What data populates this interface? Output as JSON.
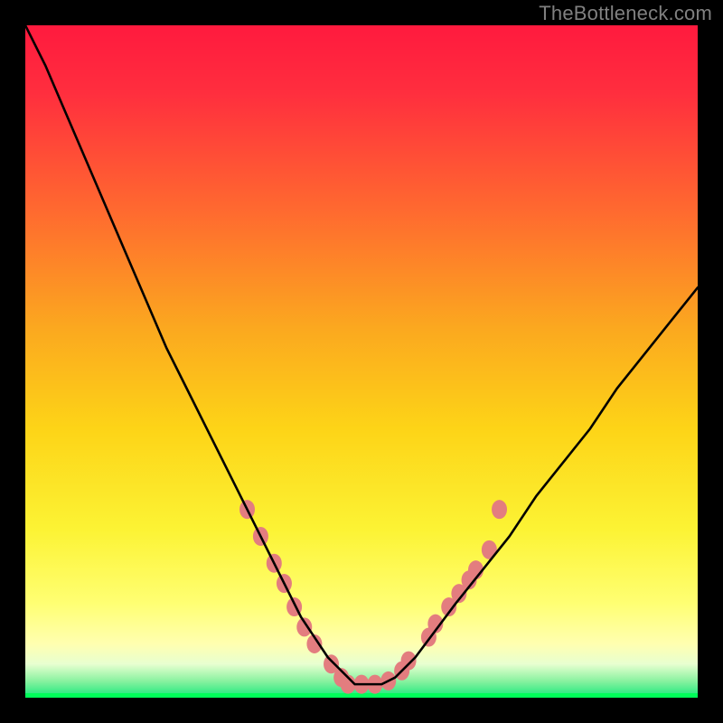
{
  "watermark": "TheBottleneck.com",
  "chart_data": {
    "type": "line",
    "title": "",
    "xlabel": "",
    "ylabel": "",
    "xlim": [
      0,
      100
    ],
    "ylim": [
      0,
      100
    ],
    "background_gradient": {
      "top": "#ff2040",
      "upper_mid": "#fdc419",
      "lower_mid": "#ffff66",
      "green_band": "#12e87a",
      "bright_green_line": "#00ff66"
    },
    "series": [
      {
        "name": "bottleneck-curve",
        "x": [
          0,
          3,
          6,
          9,
          12,
          15,
          18,
          21,
          24,
          27,
          30,
          33,
          35,
          37,
          39,
          41,
          43,
          45,
          47,
          49,
          51,
          53,
          55,
          58,
          61,
          64,
          68,
          72,
          76,
          80,
          84,
          88,
          92,
          96,
          100
        ],
        "y": [
          100,
          94,
          87,
          80,
          73,
          66,
          59,
          52,
          46,
          40,
          34,
          28,
          24,
          20,
          16,
          12,
          9,
          6,
          4,
          2,
          2,
          2,
          3,
          6,
          10,
          14,
          19,
          24,
          30,
          35,
          40,
          46,
          51,
          56,
          61
        ]
      }
    ],
    "markers": {
      "name": "data-points",
      "note": "pink rounded markers on lower part of both arms of the curve",
      "color": "#e37d7f",
      "points": [
        {
          "x": 33,
          "y": 28
        },
        {
          "x": 35,
          "y": 24
        },
        {
          "x": 37,
          "y": 20
        },
        {
          "x": 38.5,
          "y": 17
        },
        {
          "x": 40,
          "y": 13.5
        },
        {
          "x": 41.5,
          "y": 10.5
        },
        {
          "x": 43,
          "y": 8
        },
        {
          "x": 45.5,
          "y": 5
        },
        {
          "x": 47,
          "y": 3
        },
        {
          "x": 48,
          "y": 2
        },
        {
          "x": 50,
          "y": 2
        },
        {
          "x": 52,
          "y": 2
        },
        {
          "x": 54,
          "y": 2.5
        },
        {
          "x": 56,
          "y": 4
        },
        {
          "x": 57,
          "y": 5.5
        },
        {
          "x": 60,
          "y": 9
        },
        {
          "x": 61,
          "y": 11
        },
        {
          "x": 63,
          "y": 13.5
        },
        {
          "x": 64.5,
          "y": 15.5
        },
        {
          "x": 66,
          "y": 17.5
        },
        {
          "x": 67,
          "y": 19
        },
        {
          "x": 69,
          "y": 22
        },
        {
          "x": 70.5,
          "y": 28
        }
      ]
    }
  }
}
